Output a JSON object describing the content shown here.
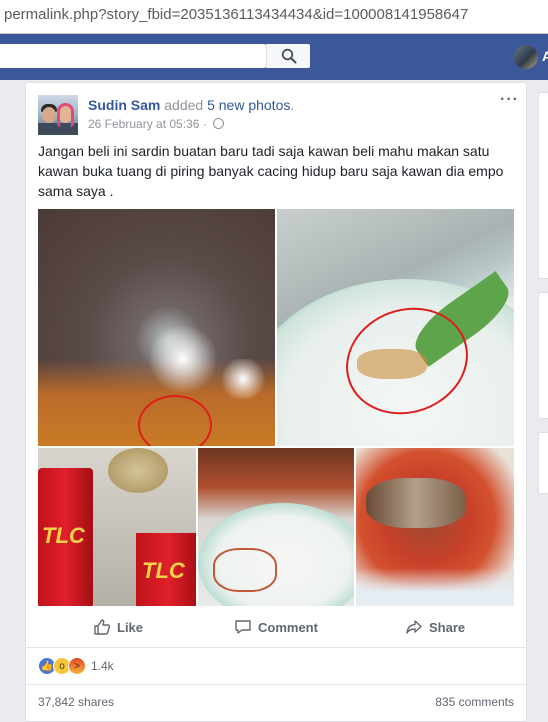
{
  "browser": {
    "url": "permalink.php?story_fbid=2035136113434434&id=100008141958647"
  },
  "topbar": {
    "search_placeholder": "",
    "user_initial": "A"
  },
  "post": {
    "author": "Sudin Sam",
    "action": " added ",
    "action_link": "5 new photos",
    "action_end": ".",
    "timestamp": "26 February at 05:36",
    "privacy_sep": " · ",
    "text": "Jangan beli ini sardin buatan baru tadi saja kawan beli mahu makan satu kawan buka tuang di piring banyak cacing hidup baru saja kawan dia empo sama saya .",
    "more": "···",
    "can_label_1": "TLC",
    "can_label_2": "TLC"
  },
  "actions": {
    "like": "Like",
    "comment": "Comment",
    "share": "Share"
  },
  "stats": {
    "reactions": "1.4k",
    "shares": "37,842 shares",
    "comments": "835 comments"
  },
  "colors": {
    "fb_blue": "#3b5998",
    "link": "#365899",
    "annotation_red": "#e01d1d"
  },
  "icons": [
    "search-icon",
    "globe-icon",
    "more-icon",
    "like-icon",
    "comment-icon",
    "share-icon",
    "like-reaction-icon",
    "wow-reaction-icon",
    "angry-reaction-icon"
  ]
}
